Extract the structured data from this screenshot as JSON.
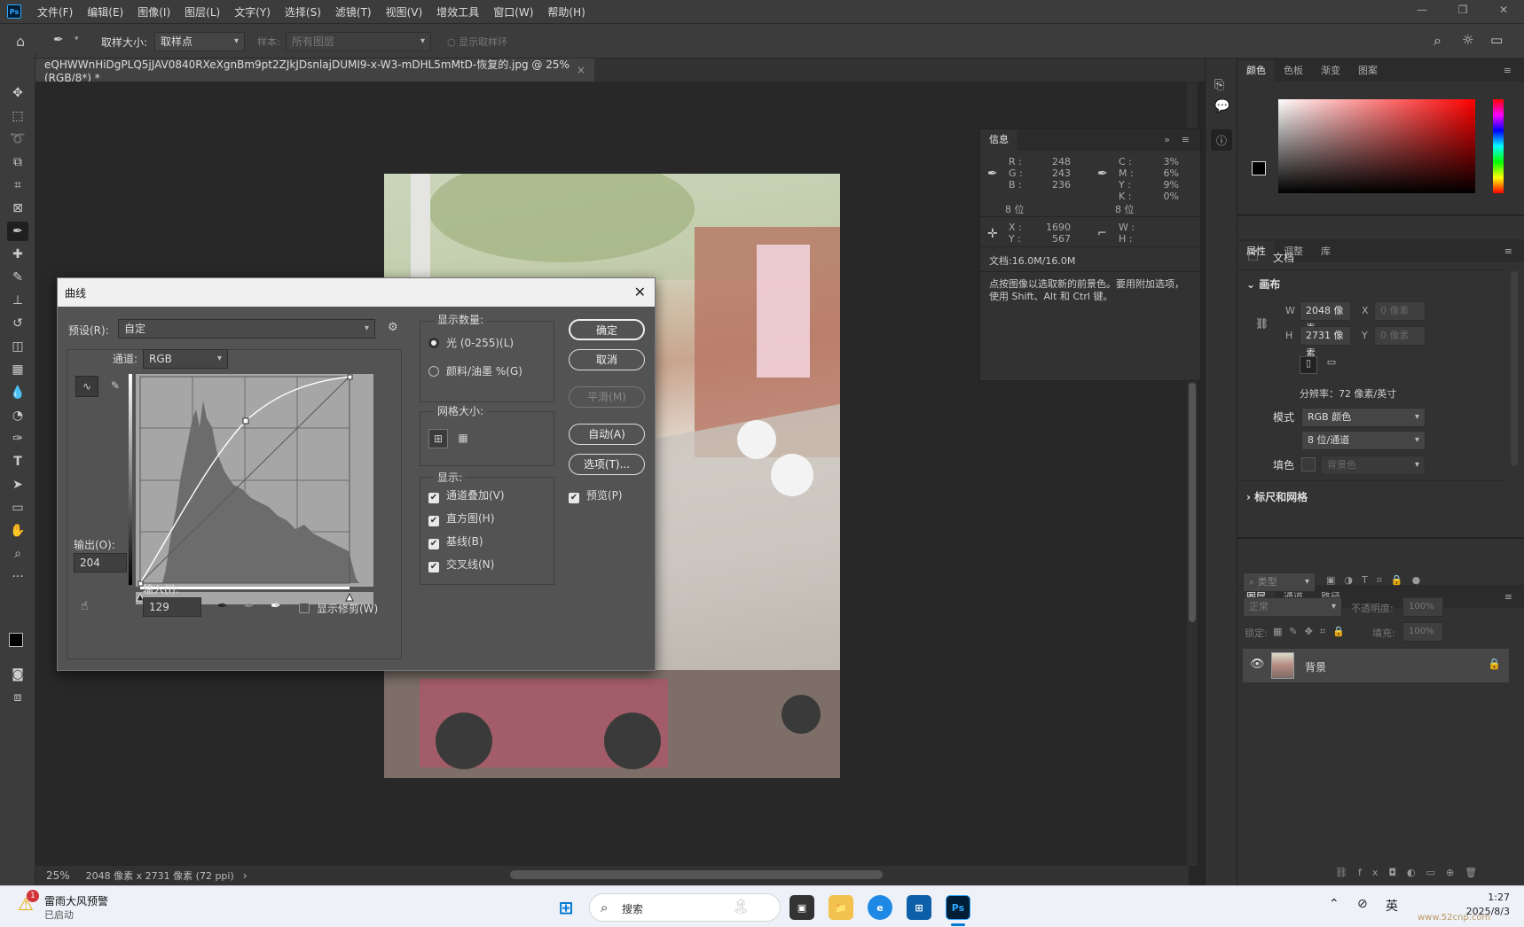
{
  "menubar": {
    "logo": "Ps",
    "items": [
      "文件(F)",
      "编辑(E)",
      "图像(I)",
      "图层(L)",
      "文字(Y)",
      "选择(S)",
      "滤镜(T)",
      "视图(V)",
      "增效工具",
      "窗口(W)",
      "帮助(H)"
    ]
  },
  "options": {
    "sample_size_label": "取样大小:",
    "sample_size_value": "取样点",
    "sample_label": "样本:",
    "sample_value": "所有图层",
    "show_ring": "显示取样环"
  },
  "doc_tab": {
    "title": "eQHWWnHiDgPLQ5jJAV0840RXeXgnBm9pt2ZJkJDsnlajDUMI9-x-W3-mDHL5mMtD-恢复的.jpg @ 25%(RGB/8*) *",
    "close": "×"
  },
  "status": {
    "zoom": "25%",
    "doc_info": "2048 像素 x 2731 像素 (72 ppi)",
    "arrow": "›"
  },
  "info_panel": {
    "tab": "信息",
    "r_label": "R :",
    "g_label": "G :",
    "b_label": "B :",
    "r": "248",
    "g": "243",
    "b": "236",
    "bits_left": "8 位",
    "c_label": "C :",
    "m_label": "M :",
    "y_label": "Y :",
    "k_label": "K :",
    "c": "3%",
    "m": "6%",
    "y": "9%",
    "k": "0%",
    "bits_right": "8 位",
    "x_label": "X :",
    "y2_label": "Y :",
    "x": "1690",
    "y2": "567",
    "w_label": "W :",
    "h_label": "H :",
    "doc": "文档:16.0M/16.0M",
    "hint": "点按图像以选取新的前景色。要用附加选项，使用 Shift、Alt 和 Ctrl 键。"
  },
  "color_panel": {
    "tabs": [
      "颜色",
      "色板",
      "渐变",
      "图案"
    ],
    "fg": "#000000",
    "bg": "#ffffff"
  },
  "props_panel": {
    "tabs": [
      "属性",
      "调整",
      "库"
    ],
    "doc_label": "文档",
    "canvas_section": "画布",
    "w_label": "W",
    "w_value": "2048 像素",
    "h_label": "H",
    "h_value": "2731 像素",
    "x_label": "X",
    "x_placeholder": "0 像素",
    "y_label": "Y",
    "y_placeholder": "0 像素",
    "resolution": "分辨率：72 像素/英寸",
    "mode_label": "模式",
    "mode_value": "RGB 颜色",
    "depth_value": "8 位/通道",
    "fill_label": "填色",
    "fill_value": "背景色",
    "rulers_section": "标尺和网格"
  },
  "layers_panel": {
    "tabs": [
      "图层",
      "通道",
      "路径"
    ],
    "search": "类型",
    "blend": "正常",
    "opacity_label": "不透明度:",
    "opacity": "100%",
    "lock_label": "锁定:",
    "fill_label": "填充:",
    "fill": "100%",
    "layer_name": "背景"
  },
  "curves": {
    "title": "曲线",
    "preset_label": "预设(R):",
    "preset_value": "自定",
    "channel_label": "通道:",
    "channel_value": "RGB",
    "output_label": "输出(O):",
    "output_value": "204",
    "input_label": "输入(I):",
    "input_value": "129",
    "show_clipping": "显示修剪(W)",
    "show_amount_title": "显示数量:",
    "light_option": "光 (0-255)(L)",
    "pigment_option": "颜料/油墨 %(G)",
    "grid_size_title": "网格大小:",
    "show_title": "显示:",
    "channel_overlay": "通道叠加(V)",
    "histogram": "直方图(H)",
    "baseline": "基线(B)",
    "intersection": "交叉线(N)",
    "ok": "确定",
    "cancel": "取消",
    "smooth": "平滑(M)",
    "auto": "自动(A)",
    "options": "选项(T)...",
    "preview": "预览(P)"
  },
  "taskbar": {
    "weather_title": "雷雨大风预警",
    "weather_sub": "已启动",
    "badge": "1",
    "search": "搜索",
    "ime": "英",
    "time": "1:27",
    "date": "2025/8/3",
    "watermark": "www.52cnp.com"
  }
}
